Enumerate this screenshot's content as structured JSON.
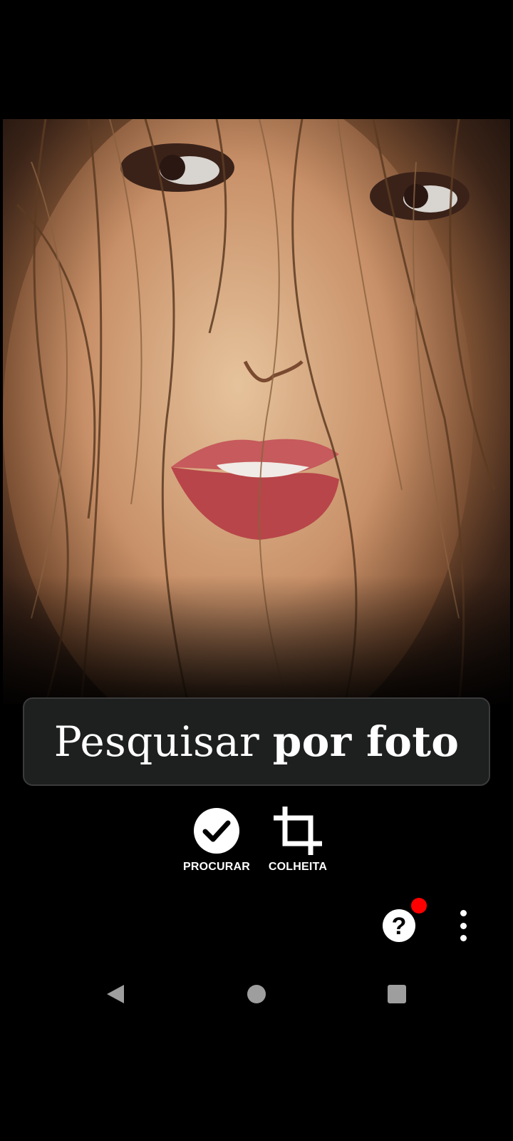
{
  "banner": {
    "title_regular": "Pesquisar",
    "title_bold": "por foto"
  },
  "actions": {
    "search_label": "PROCURAR",
    "crop_label": "COLHEITA"
  },
  "icons": {
    "search": "check-circle-icon",
    "crop": "crop-icon",
    "help": "help-circle-icon",
    "more": "more-vertical-icon",
    "back": "nav-back-icon",
    "home": "nav-home-icon",
    "recents": "nav-recents-icon"
  },
  "colors": {
    "background": "#000000",
    "banner_background": "#1e1f1f",
    "notification": "#ff0000",
    "icon": "#ffffff",
    "nav_icon": "#9e9e9e"
  }
}
